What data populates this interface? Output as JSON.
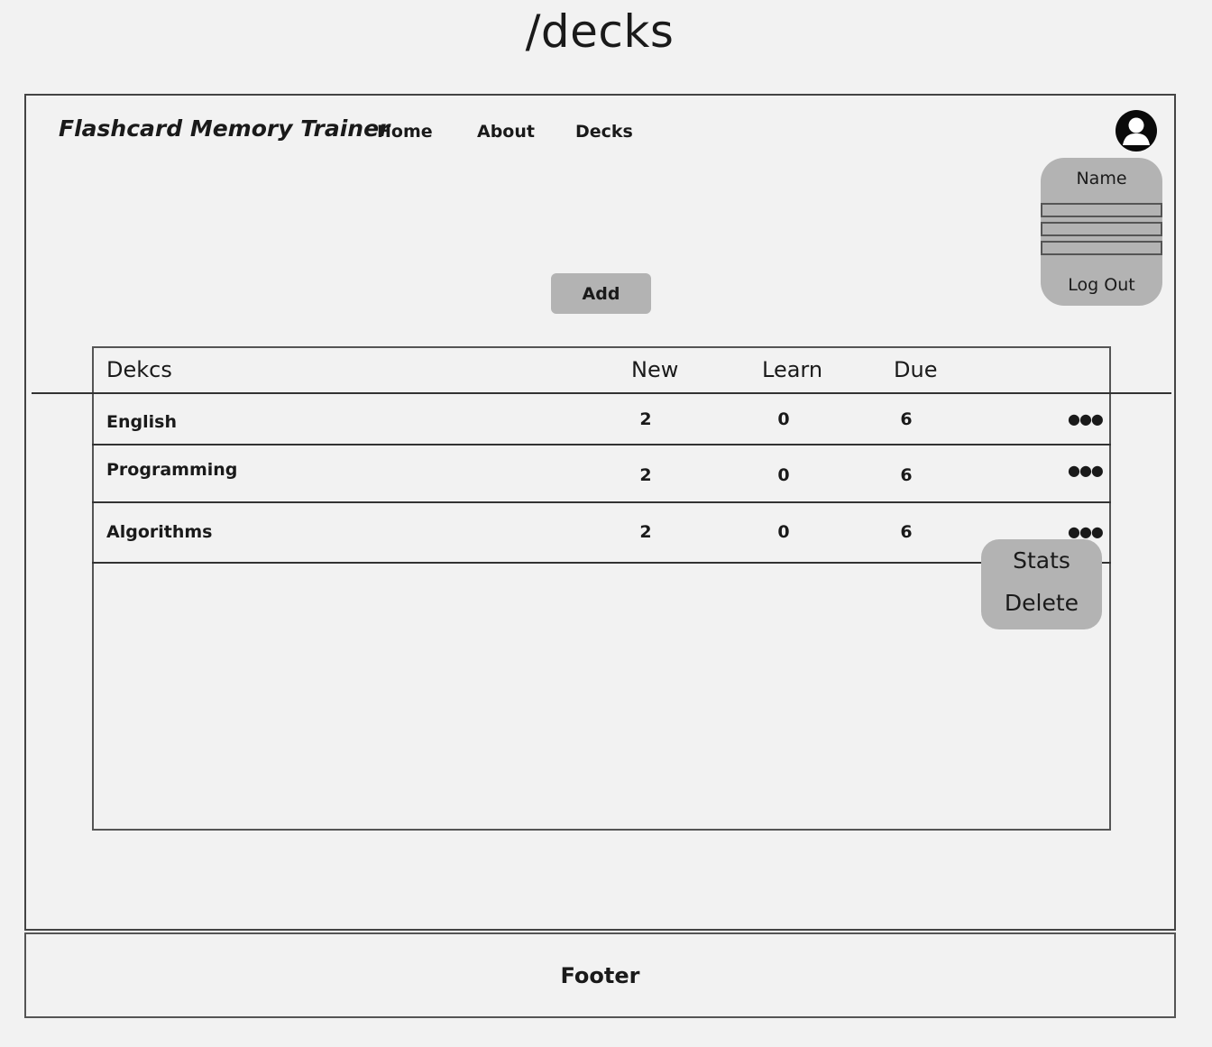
{
  "route_title": "/decks",
  "nav": {
    "brand": "Flashcard Memory Trainer",
    "links": [
      "Home",
      "About",
      "Decks"
    ]
  },
  "user_menu": {
    "name": "Name",
    "logout": "Log Out"
  },
  "toolbar": {
    "add_label": "Add"
  },
  "table": {
    "headers": [
      "Dekcs",
      "New",
      "Learn",
      "Due"
    ],
    "rows": [
      {
        "name": "English",
        "new": "2",
        "learn": "0",
        "due": "6"
      },
      {
        "name": "Programming",
        "new": "2",
        "learn": "0",
        "due": "6"
      },
      {
        "name": "Algorithms",
        "new": "2",
        "learn": "0",
        "due": "6"
      }
    ],
    "more_glyph": "●●●"
  },
  "row_menu": {
    "items": [
      "Stats",
      "Delete"
    ]
  },
  "footer": {
    "label": "Footer"
  }
}
